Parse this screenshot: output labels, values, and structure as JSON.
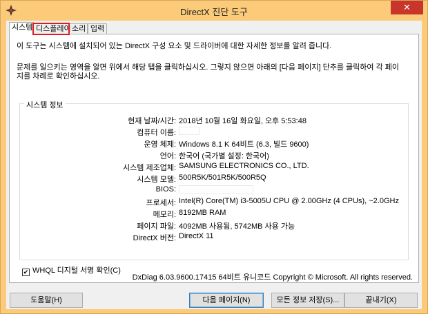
{
  "window": {
    "title": "DirectX 진단 도구",
    "close_glyph": "✕"
  },
  "tabs": [
    {
      "label": "시스템"
    },
    {
      "label": "디스플레이"
    },
    {
      "label": "소리"
    },
    {
      "label": "입력"
    }
  ],
  "intro": {
    "line1": "이 도구는 시스템에 설치되어 있는 DirectX 구성 요소 및 드라이버에 대한 자세한 정보를 알려 줍니다.",
    "line2": "문제를 일으키는 영역을 알면 위에서 해당 탭을 클릭하십시오. 그렇지 않으면 아래의 [다음 페이지] 단추를 클릭하여 각 페이지를 차례로 확인하십시오."
  },
  "system_info": {
    "group_title": "시스템 정보",
    "rows": [
      {
        "label": "현재 날짜/시간:",
        "value": "2018년 10월 16일 화요일, 오후 5:53:48"
      },
      {
        "label": "컴퓨터 이름:",
        "value": ""
      },
      {
        "label": "운영 체제:",
        "value": "Windows 8.1 K 64비트 (6.3, 빌드 9600)"
      },
      {
        "label": "언어:",
        "value": "한국어 (국가별 설정: 한국어)"
      },
      {
        "label": "시스템 제조업체:",
        "value": "SAMSUNG ELECTRONICS CO., LTD."
      },
      {
        "label": "시스템 모델:",
        "value": "500R5K/501R5K/500R5Q"
      },
      {
        "label": "BIOS:",
        "value": ""
      },
      {
        "label": "프로세서:",
        "value": "Intel(R) Core(TM) i3-5005U CPU @ 2.00GHz (4 CPUs), ~2.0GHz"
      },
      {
        "label": "메모리:",
        "value": "8192MB RAM"
      },
      {
        "label": "페이지 파일:",
        "value": "4092MB 사용됨, 5742MB 사용 가능"
      },
      {
        "label": "DirectX 버전:",
        "value": "DirectX 11"
      }
    ]
  },
  "whql": {
    "label": "WHQL 디지털 서명 확인(C)",
    "checked_glyph": "✔"
  },
  "footer_text": "DxDiag 6.03.9600.17415 64비트 유니코드  Copyright © Microsoft. All rights reserved.",
  "buttons": {
    "help": "도움말(H)",
    "next_page": "다음 페이지(N)",
    "save_all": "모든 정보 저장(S)...",
    "exit": "끝내기(X)"
  }
}
